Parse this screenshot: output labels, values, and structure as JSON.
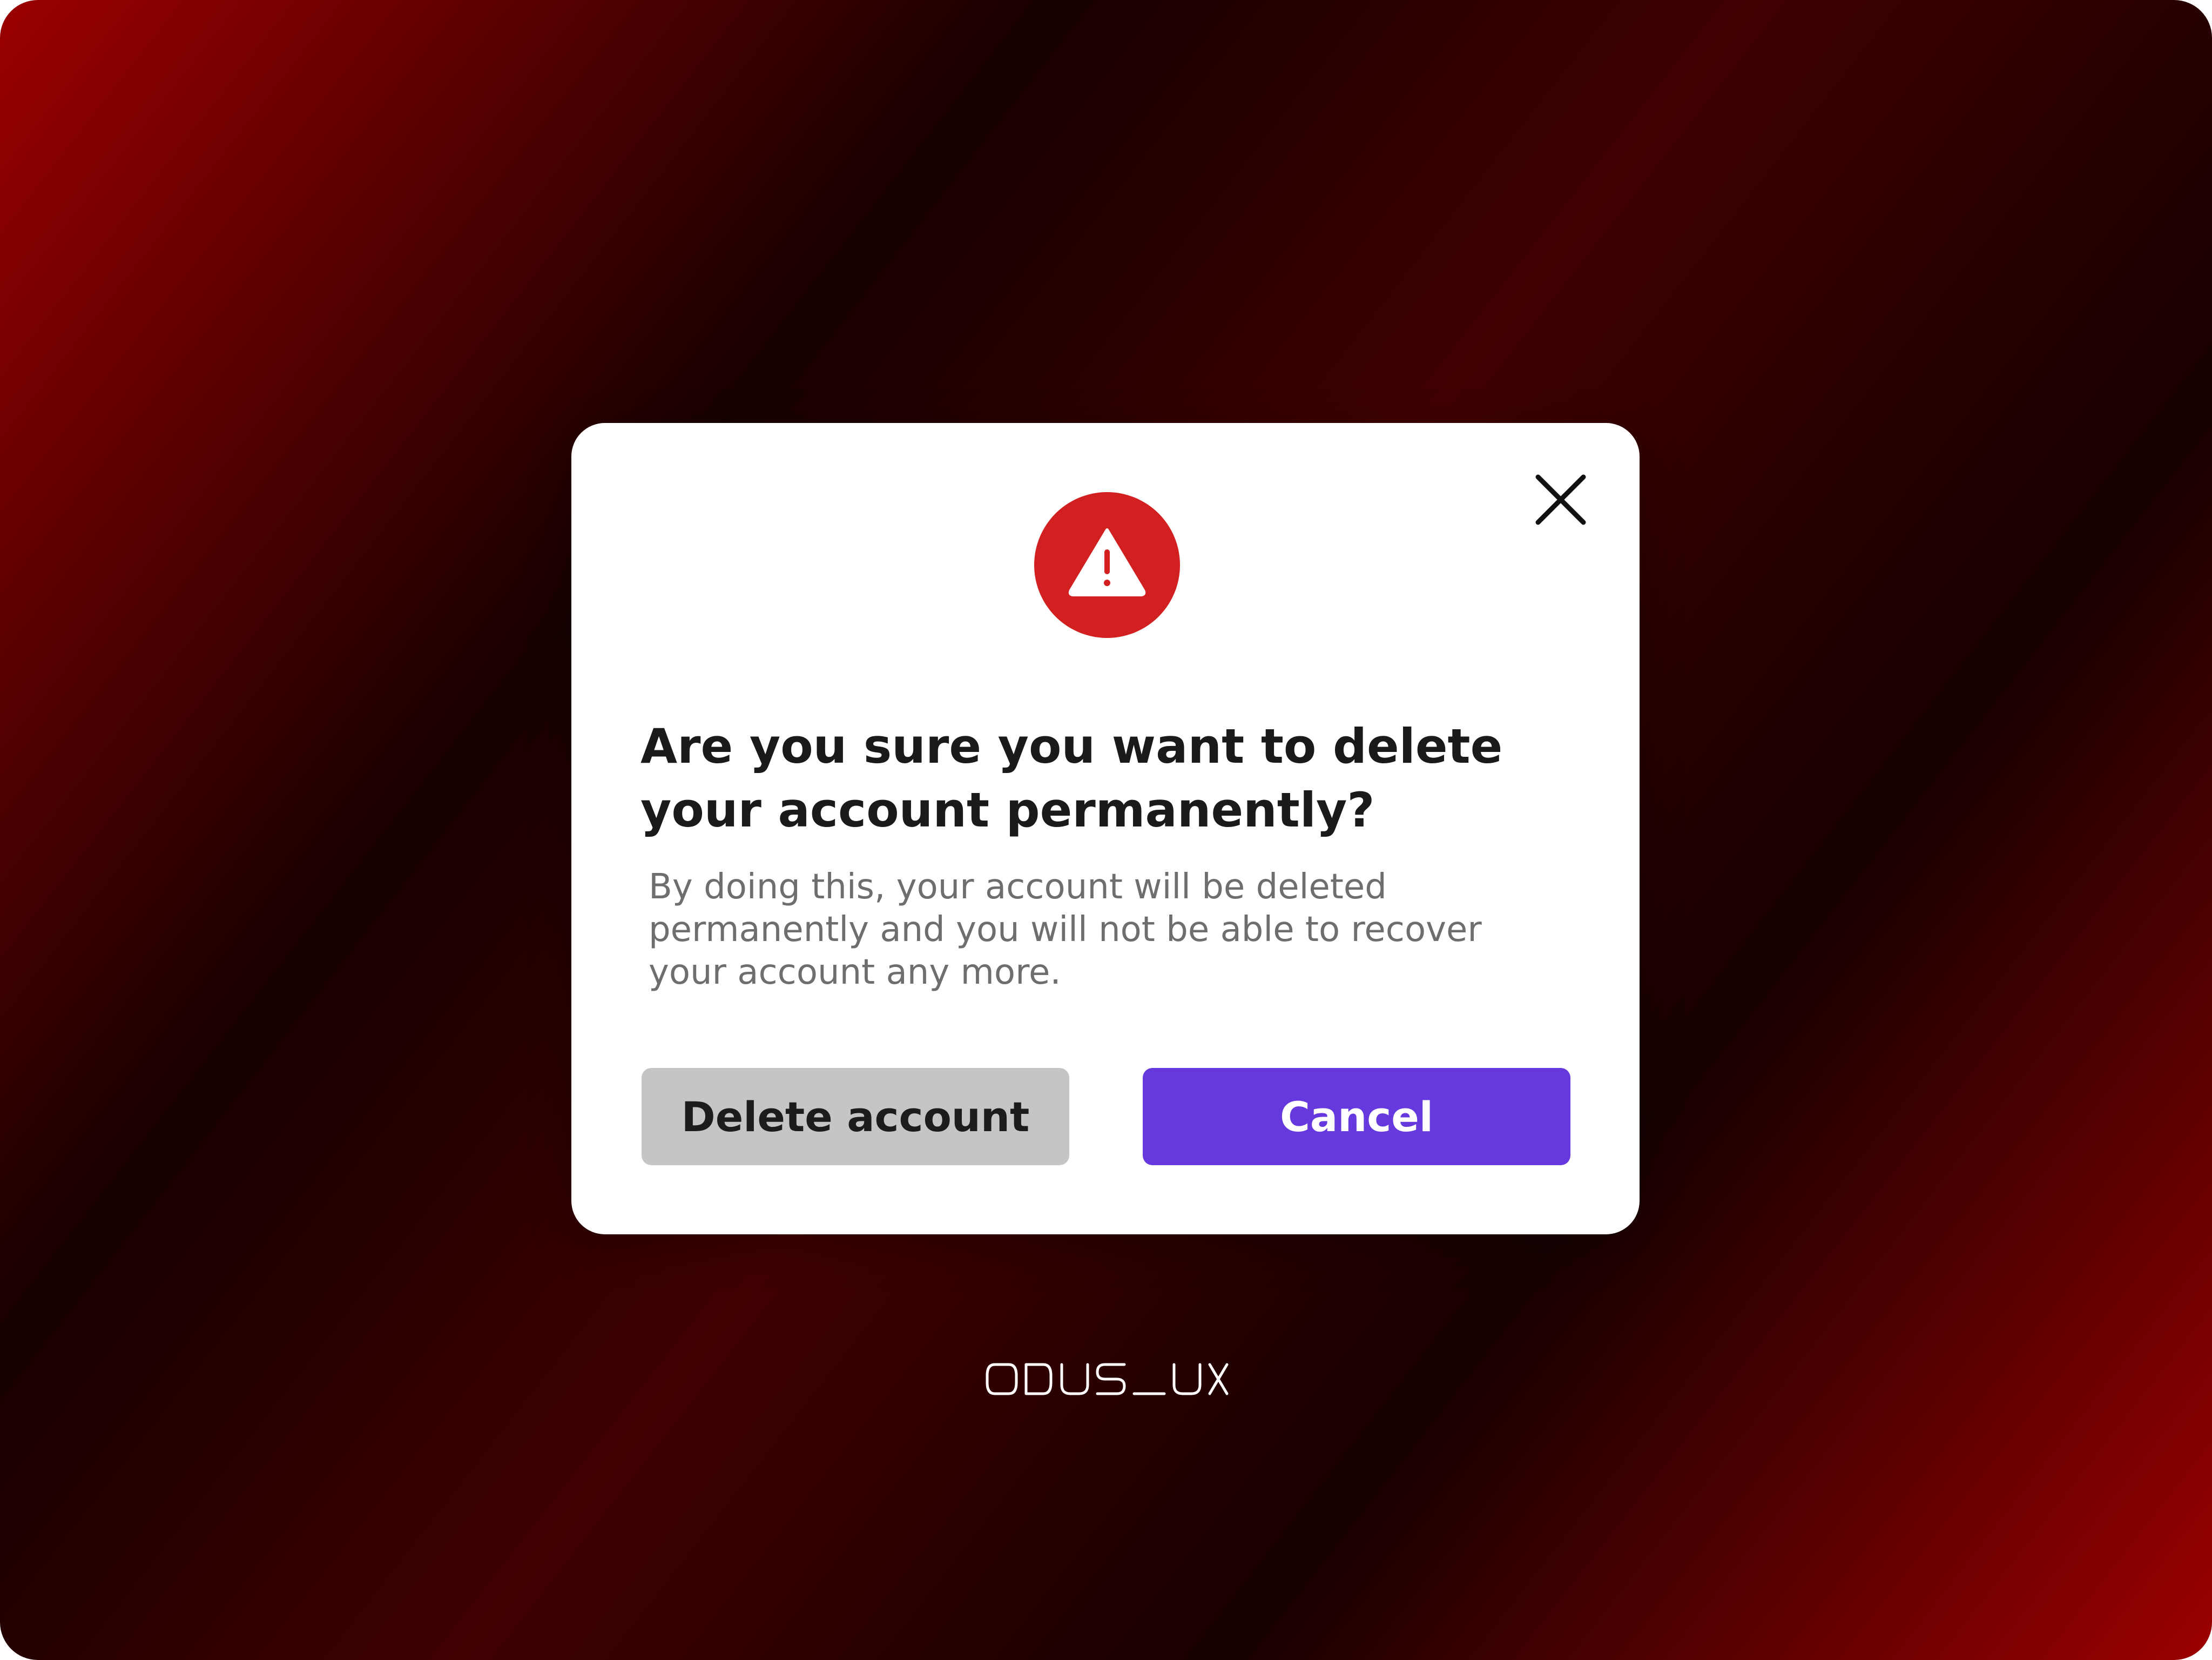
{
  "background": {
    "gradient_colors": [
      "#9c0000",
      "#170000",
      "#3f0000",
      "#170000",
      "#9c0000"
    ]
  },
  "dialog": {
    "icon": "warning-triangle-icon",
    "icon_color": "#d21f1f",
    "close_icon": "close-icon",
    "title": "Are you sure you want to delete your account permanently?",
    "description": "By doing this, your account will be deleted permanently and you will not be able to recover your account any more.",
    "delete_label": "Delete account",
    "cancel_label": "Cancel",
    "delete_color": "#c5c5c5",
    "cancel_color": "#6539dd"
  },
  "branding": {
    "logo_text": "ODUS_UX"
  }
}
